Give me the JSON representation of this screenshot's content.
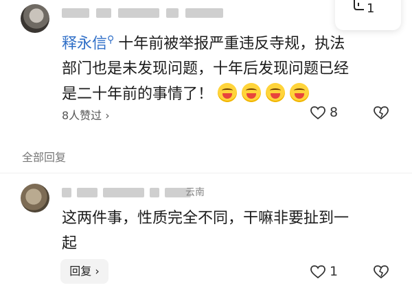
{
  "top_comment": {
    "reply_count": "1",
    "mention": "释永信",
    "text_line1": "十年前被举报严重违反寺规，执法",
    "text_line2": "部门也是未发现问题，十年后发现问题已经",
    "text_line3": "是二十年前的事情了！",
    "likes_text": "8人赞过 ›",
    "like_count": "8"
  },
  "section": {
    "all_replies": "全部回复"
  },
  "reply": {
    "location": "云南",
    "text_line1": "这两件事，性质完全不同，干嘛非要扯到一",
    "text_line2": "起",
    "reply_button": "回复 ›",
    "like_count": "1"
  },
  "icons": {
    "mention": "search-mention-icon",
    "reply": "reply-corner-icon",
    "like": "heart-outline-icon",
    "dislike": "broken-heart-icon",
    "emoji": "laughing-emoji-icon"
  },
  "colors": {
    "mention": "#2e6ec7",
    "muted": "#777777",
    "text": "#1c1c1c"
  }
}
